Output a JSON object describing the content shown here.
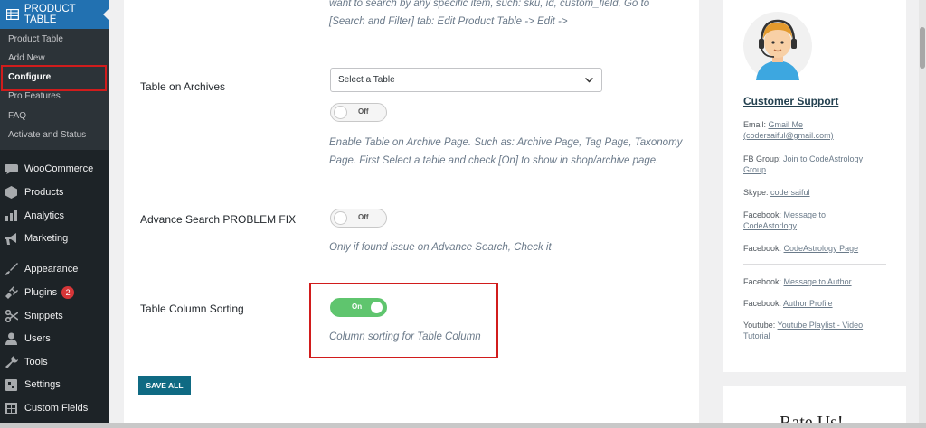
{
  "sidebar": {
    "plugin_title": "PRODUCT TABLE",
    "submenu": [
      {
        "label": "Product Table"
      },
      {
        "label": "Add New"
      },
      {
        "label": "Configure"
      },
      {
        "label": "Pro Features"
      },
      {
        "label": "FAQ"
      },
      {
        "label": "Activate and Status"
      }
    ],
    "menu": [
      {
        "label": "WooCommerce",
        "icon": "woocommerce-icon"
      },
      {
        "label": "Products",
        "icon": "products-icon"
      },
      {
        "label": "Analytics",
        "icon": "analytics-icon"
      },
      {
        "label": "Marketing",
        "icon": "marketing-icon"
      },
      {
        "label": "Appearance",
        "icon": "appearance-icon"
      },
      {
        "label": "Plugins",
        "icon": "plugins-icon",
        "badge": "2"
      },
      {
        "label": "Snippets",
        "icon": "snippets-icon"
      },
      {
        "label": "Users",
        "icon": "users-icon"
      },
      {
        "label": "Tools",
        "icon": "tools-icon"
      },
      {
        "label": "Settings",
        "icon": "settings-icon"
      },
      {
        "label": "Custom Fields",
        "icon": "custom-fields-icon"
      }
    ],
    "colors": {
      "bg": "#1d2327",
      "active": "#2271b1",
      "highlight_border": "#d11c1c"
    }
  },
  "main": {
    "top_desc_line1": "want to search by any specific item, such: sku, id, custom_field, Go to",
    "top_desc_line2": "[Search and Filter] tab: Edit Product Table -> Edit ->",
    "archives": {
      "label": "Table on Archives",
      "select_value": "Select a Table",
      "toggle": "Off",
      "desc_line1": "Enable Table on Archive Page. Such as: Archive Page, Tag Page, Taxonomy",
      "desc_line2": "Page. First Select a table and check [On] to show in shop/archive page."
    },
    "advance_search": {
      "label": "Advance Search PROBLEM FIX",
      "toggle": "Off",
      "desc": "Only if found issue on Advance Search, Check it"
    },
    "column_sorting": {
      "label": "Table Column Sorting",
      "toggle": "On",
      "desc": "Column sorting for Table Column"
    },
    "save_label": "SAVE ALL"
  },
  "support": {
    "title": "Customer Support",
    "email_label": "Email: ",
    "email_link": "Gmail Me",
    "email_address": "(codersaiful@gmail.com)",
    "fb_group_label": "FB Group: ",
    "fb_group_link_1": "Join to CodeAstrology",
    "fb_group_link_2": "Group",
    "skype_label": "Skype: ",
    "skype_link": "codersaiful",
    "facebook_label": "Facebook: ",
    "fb_msg_link_1": "Message to",
    "fb_msg_link_2": "CodeAstorlogy",
    "fb_page_link": "CodeAstrology Page",
    "fb_author_msg_link": "Message to Author",
    "fb_author_profile_link": "Author Profile",
    "youtube_label": "Youtube: ",
    "youtube_link_1": "Youtube Playlist - Video",
    "youtube_link_2": "Tutorial"
  },
  "rate": {
    "title": "Rate Us!"
  }
}
